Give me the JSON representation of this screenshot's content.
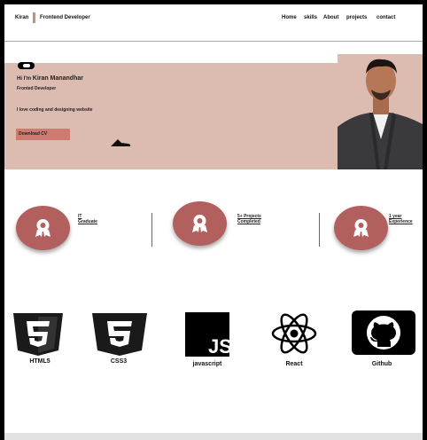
{
  "header": {
    "logo": "Kiran",
    "role": "Frontend Developer",
    "nav": [
      "Home",
      "skills",
      "About",
      "projects",
      "contact"
    ]
  },
  "hero": {
    "greeting": "Hi I'm",
    "name": "Kiran Manandhar",
    "role": "Fronted Developer",
    "tagline": "I love coding and designing website",
    "download_label": "Download CV"
  },
  "stats": [
    {
      "line1": "IT",
      "line2": "Graduate"
    },
    {
      "line1": "5+ Projects",
      "line2": "Completed"
    },
    {
      "line1": "1 year",
      "line2": "Experience"
    }
  ],
  "skills": [
    {
      "label": "HTML5",
      "icon": "html5-icon"
    },
    {
      "label": "CSS3",
      "icon": "css3-icon"
    },
    {
      "label": "javascript",
      "icon": "javascript-icon"
    },
    {
      "label": "React",
      "icon": "react-icon"
    },
    {
      "label": "Github",
      "icon": "github-icon"
    }
  ],
  "colors": {
    "hero_bg": "#dcbbb1",
    "accent": "#cc7b70",
    "stat_circle": "#b2605d"
  }
}
